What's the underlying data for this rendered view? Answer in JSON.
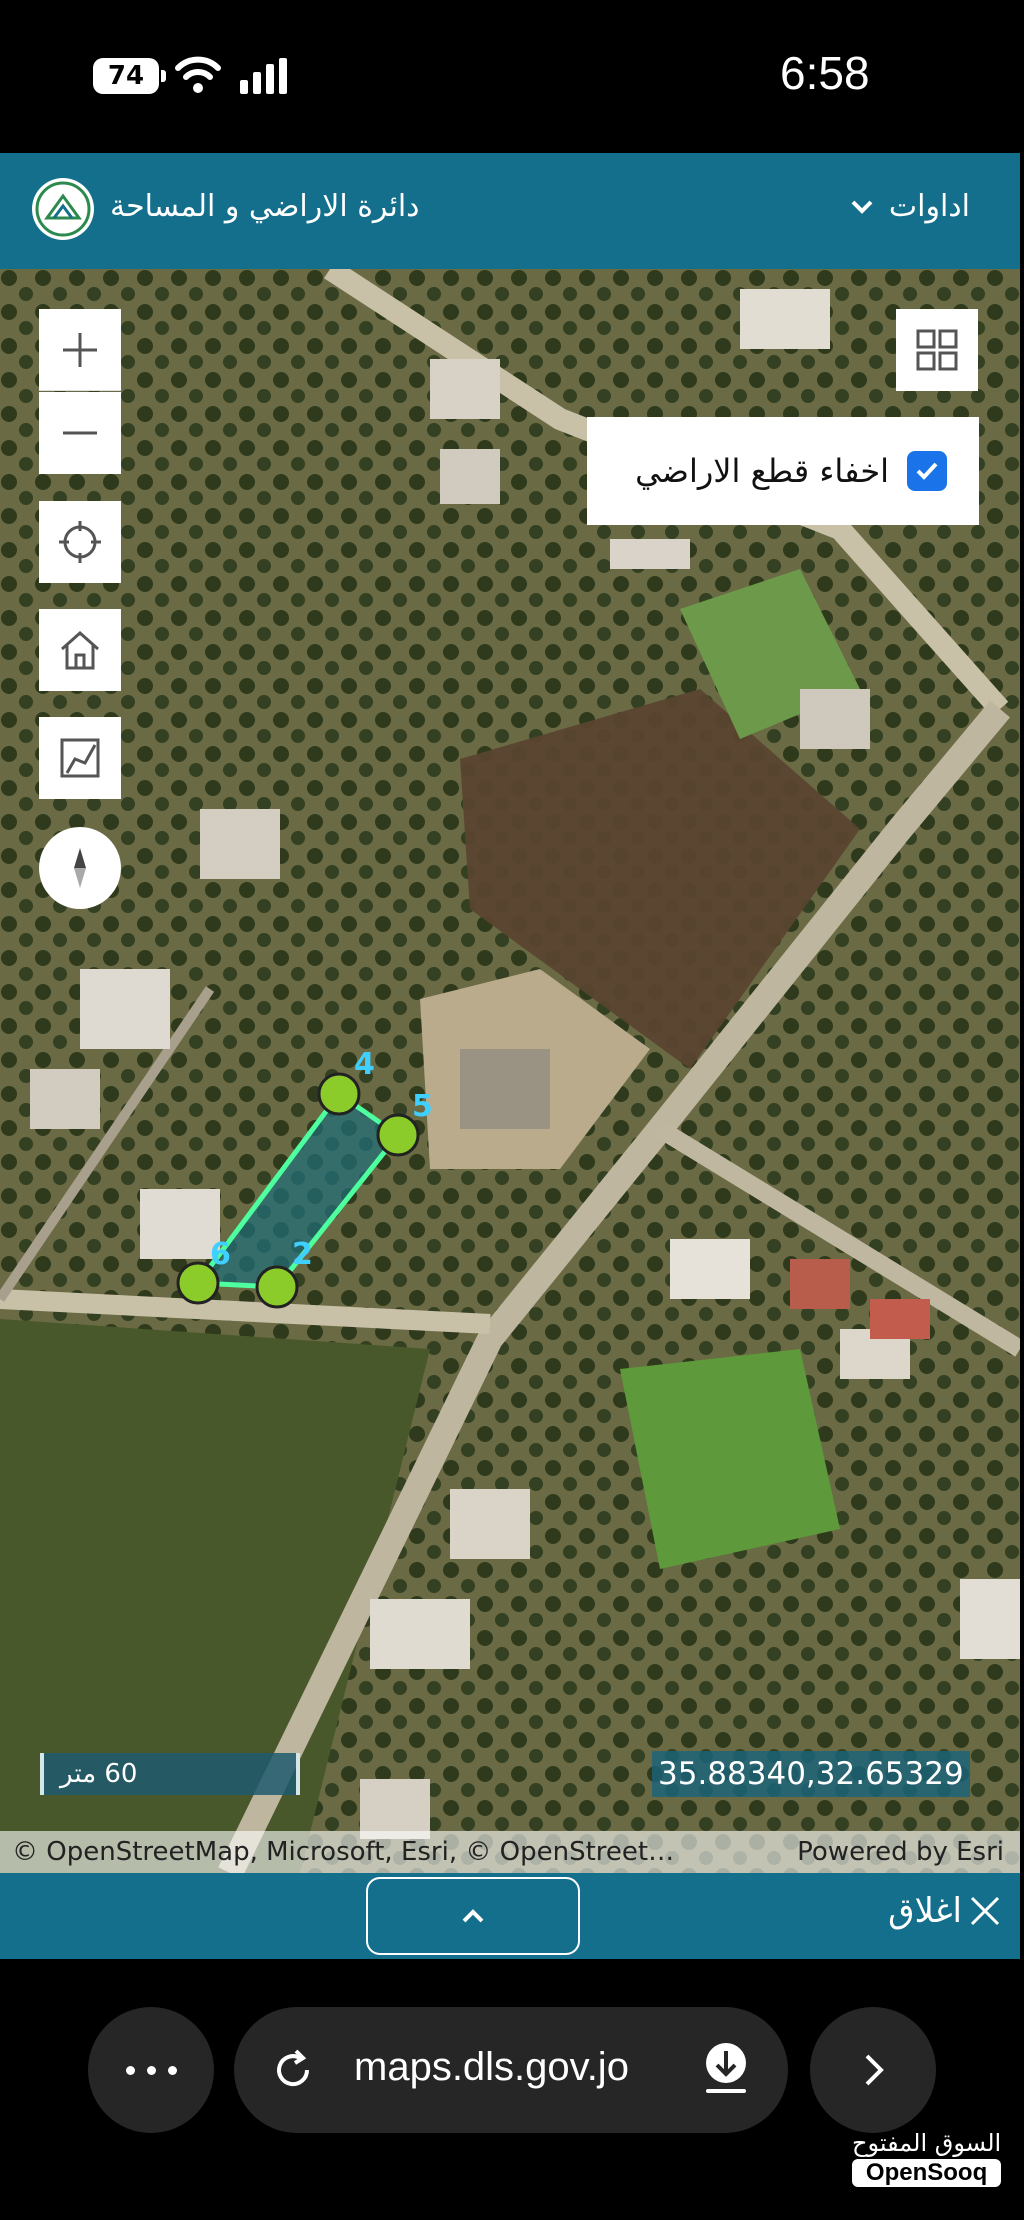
{
  "status_bar": {
    "battery": "74",
    "time": "6:58"
  },
  "header": {
    "title": "دائرة الاراضي و المساحة",
    "tools_label": "اداوات"
  },
  "map": {
    "layer_toggle": {
      "label": "اخفاء قطع الاراضي",
      "checked": true
    },
    "scale_label": "60 متر",
    "coordinates": "35.88340,32.65329",
    "attribution": "© OpenStreetMap, Microsoft, Esri, © OpenStreet…",
    "powered_by": "Powered by Esri",
    "parcel_vertices": [
      "4",
      "5",
      "6",
      "2"
    ]
  },
  "bottom_panel": {
    "close_label": "اغلاق"
  },
  "browser": {
    "url": "maps.dls.gov.jo"
  },
  "watermark": {
    "arabic": "السوق المفتوح",
    "latin": "OpenSooq"
  }
}
